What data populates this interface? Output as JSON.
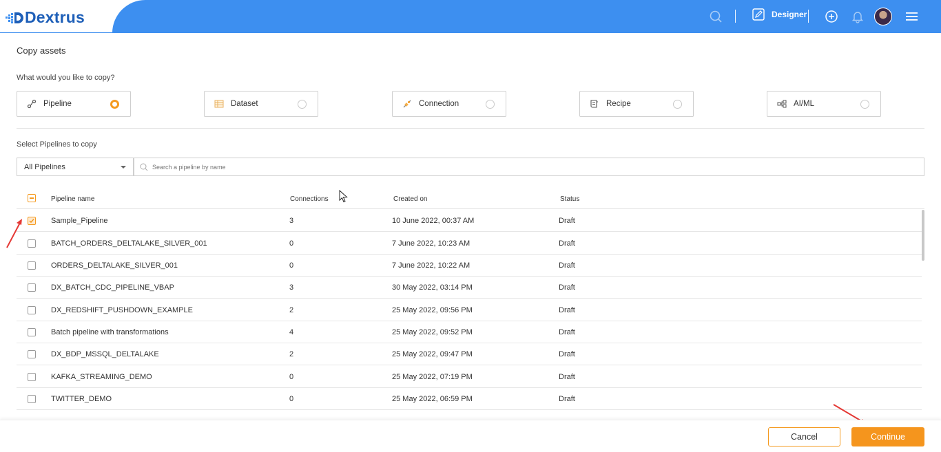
{
  "app": {
    "brand": "Dextrus",
    "brand_color": "#1e5fb8",
    "header_color": "#3d8ff0",
    "accent_color": "#f5951d"
  },
  "header": {
    "designer_label": "Designer",
    "icons": [
      "search-icon",
      "designer-edit-icon",
      "add-circle-icon",
      "bell-icon",
      "avatar",
      "menu-icon"
    ]
  },
  "page": {
    "title": "Copy assets",
    "question": "What would you like to copy?"
  },
  "asset_types": [
    {
      "label": "Pipeline",
      "icon": "pipeline-icon",
      "selected": true
    },
    {
      "label": "Dataset",
      "icon": "dataset-icon",
      "selected": false
    },
    {
      "label": "Connection",
      "icon": "connection-icon",
      "selected": false
    },
    {
      "label": "Recipe",
      "icon": "recipe-icon",
      "selected": false
    },
    {
      "label": "AI/ML",
      "icon": "aiml-icon",
      "selected": false
    }
  ],
  "filter": {
    "select_label": "Select Pipelines to copy",
    "dropdown_value": "All Pipelines",
    "search_placeholder": "Search a pipeline by name"
  },
  "table": {
    "columns": [
      "Pipeline name",
      "Connections",
      "Created on",
      "Status"
    ],
    "rows": [
      {
        "name": "Sample_Pipeline",
        "connections": "3",
        "created": "10 June 2022, 00:37 AM",
        "status": "Draft",
        "checked": true
      },
      {
        "name": "BATCH_ORDERS_DELTALAKE_SILVER_001",
        "connections": "0",
        "created": "7 June 2022, 10:23 AM",
        "status": "Draft",
        "checked": false
      },
      {
        "name": "ORDERS_DELTALAKE_SILVER_001",
        "connections": "0",
        "created": "7 June 2022, 10:22 AM",
        "status": "Draft",
        "checked": false
      },
      {
        "name": "DX_BATCH_CDC_PIPELINE_VBAP",
        "connections": "3",
        "created": "30 May 2022, 03:14 PM",
        "status": "Draft",
        "checked": false
      },
      {
        "name": "DX_REDSHIFT_PUSHDOWN_EXAMPLE",
        "connections": "2",
        "created": "25 May 2022, 09:56 PM",
        "status": "Draft",
        "checked": false
      },
      {
        "name": "Batch pipeline with transformations",
        "connections": "4",
        "created": "25 May 2022, 09:52 PM",
        "status": "Draft",
        "checked": false
      },
      {
        "name": "DX_BDP_MSSQL_DELTALAKE",
        "connections": "2",
        "created": "25 May 2022, 09:47 PM",
        "status": "Draft",
        "checked": false
      },
      {
        "name": "KAFKA_STREAMING_DEMO",
        "connections": "0",
        "created": "25 May 2022, 07:19 PM",
        "status": "Draft",
        "checked": false
      },
      {
        "name": "TWITTER_DEMO",
        "connections": "0",
        "created": "25 May 2022, 06:59 PM",
        "status": "Draft",
        "checked": false
      }
    ]
  },
  "footer": {
    "cancel_label": "Cancel",
    "continue_label": "Continue"
  }
}
